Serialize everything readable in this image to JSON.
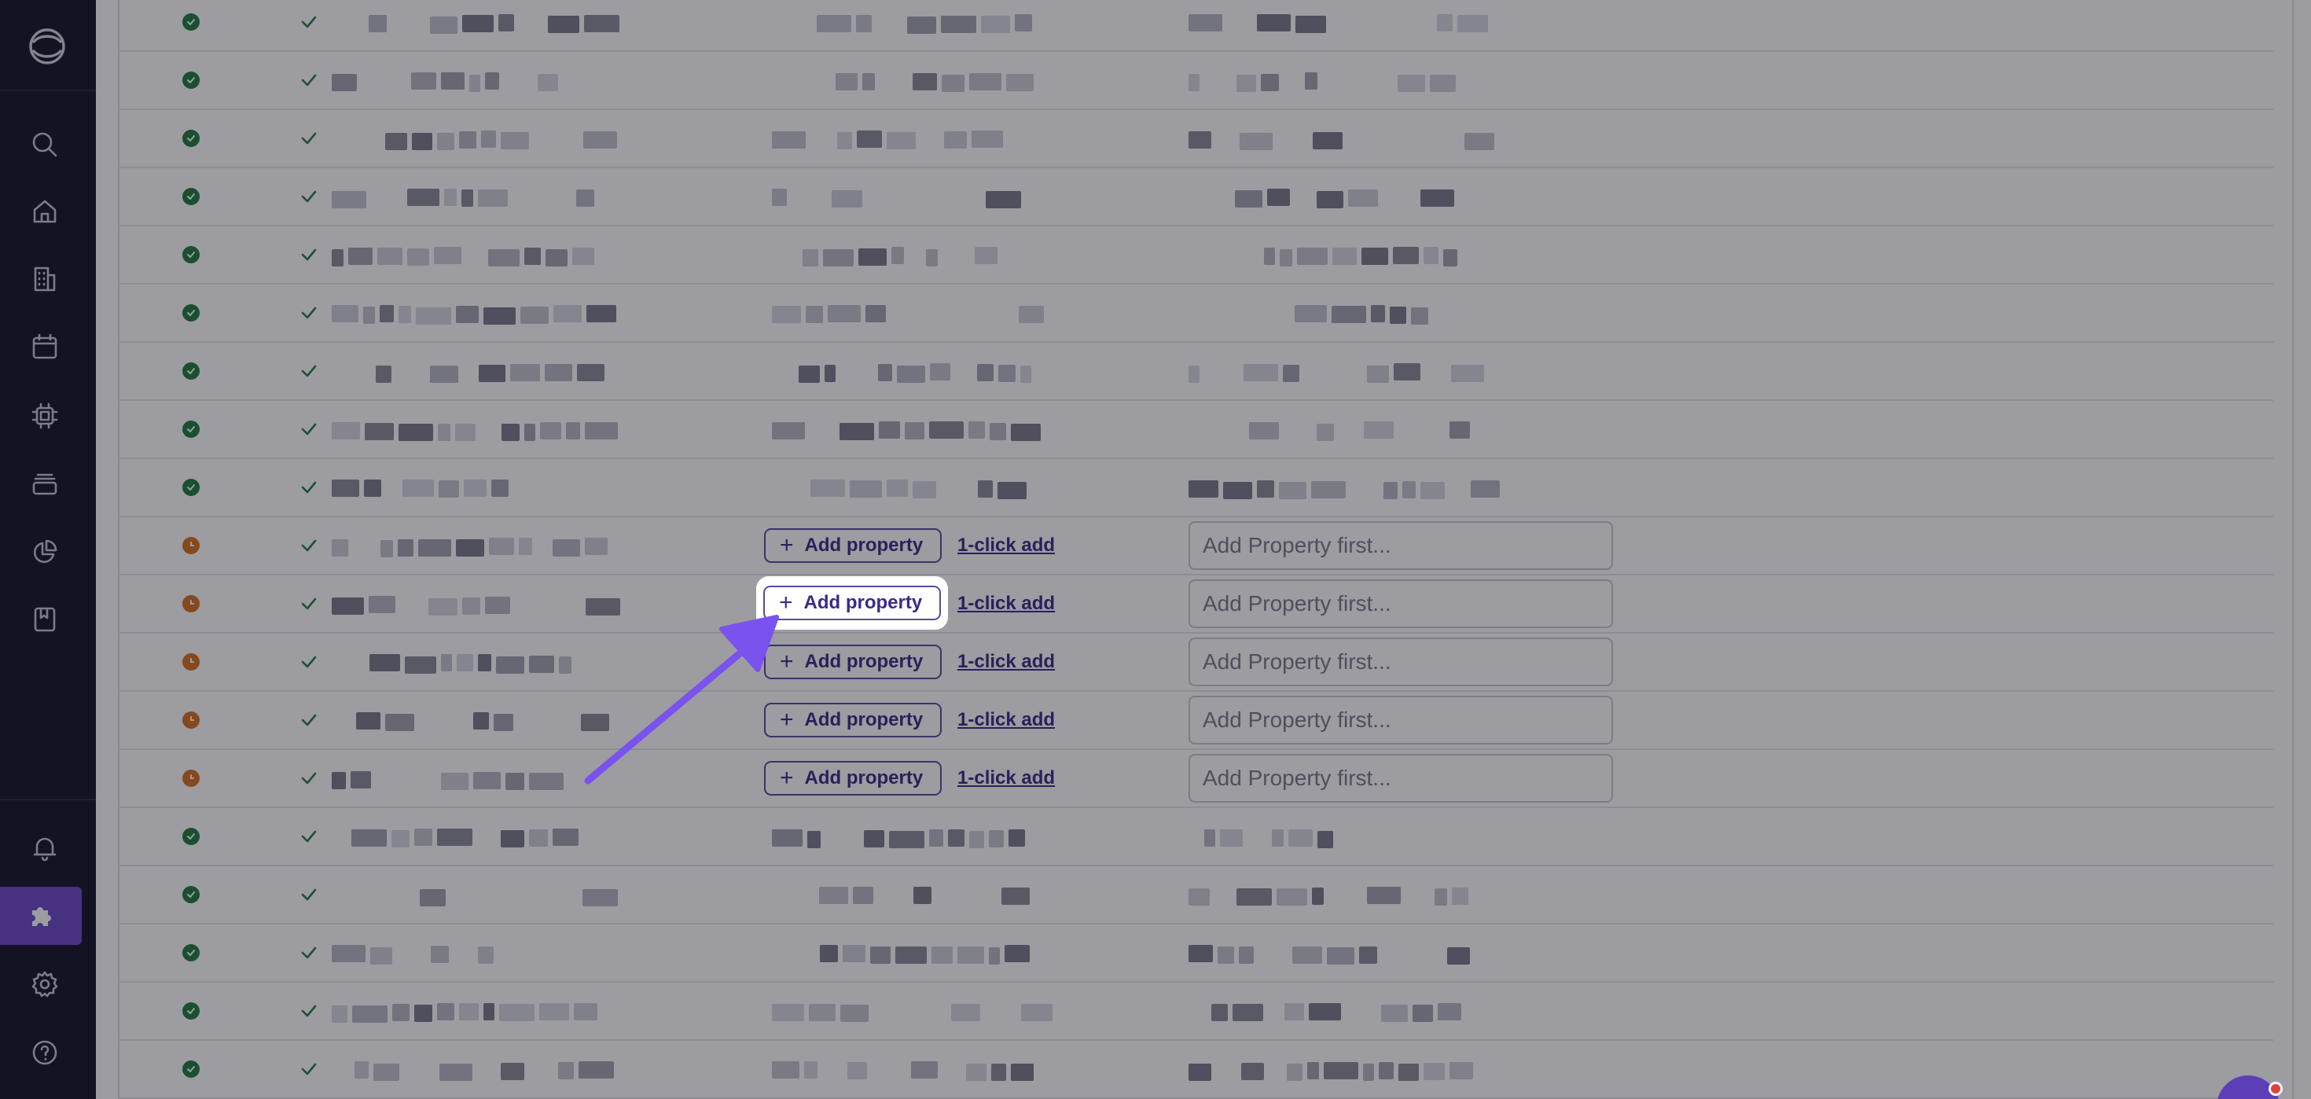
{
  "sidebar": {
    "logo_icon": "brand-ring-logo",
    "nav_icons": [
      "search-icon",
      "home-icon",
      "building-icon",
      "calendar-icon",
      "chip-icon",
      "inbox-icon",
      "pie-chart-icon",
      "book-icon"
    ],
    "bottom_icons": [
      "bell-icon",
      "puzzle-icon",
      "gear-icon",
      "help-icon"
    ],
    "active_item": "puzzle-icon",
    "accent_color": "#6b49c8"
  },
  "table": {
    "rows": [
      {
        "status": "ok",
        "checked": true,
        "has_property": true
      },
      {
        "status": "ok",
        "checked": true,
        "has_property": true
      },
      {
        "status": "ok",
        "checked": true,
        "has_property": true
      },
      {
        "status": "ok",
        "checked": true,
        "has_property": true
      },
      {
        "status": "ok",
        "checked": true,
        "has_property": true
      },
      {
        "status": "ok",
        "checked": true,
        "has_property": true
      },
      {
        "status": "ok",
        "checked": true,
        "has_property": true
      },
      {
        "status": "ok",
        "checked": true,
        "has_property": true
      },
      {
        "status": "ok",
        "checked": true,
        "has_property": true
      },
      {
        "status": "pending",
        "checked": true,
        "has_property": false,
        "add_property_label": "Add property",
        "one_click_label": "1-click add",
        "input_placeholder": "Add Property first..."
      },
      {
        "status": "pending",
        "checked": true,
        "has_property": false,
        "add_property_label": "Add property",
        "one_click_label": "1-click add",
        "input_placeholder": "Add Property first..."
      },
      {
        "status": "pending",
        "checked": true,
        "has_property": false,
        "add_property_label": "Add property",
        "one_click_label": "1-click add",
        "input_placeholder": "Add Property first..."
      },
      {
        "status": "pending",
        "checked": true,
        "has_property": false,
        "add_property_label": "Add property",
        "one_click_label": "1-click add",
        "input_placeholder": "Add Property first..."
      },
      {
        "status": "pending",
        "checked": true,
        "has_property": false,
        "add_property_label": "Add property",
        "one_click_label": "1-click add",
        "input_placeholder": "Add Property first..."
      },
      {
        "status": "ok",
        "checked": true,
        "has_property": true
      },
      {
        "status": "ok",
        "checked": true,
        "has_property": true
      },
      {
        "status": "ok",
        "checked": true,
        "has_property": true
      },
      {
        "status": "ok",
        "checked": true,
        "has_property": true
      },
      {
        "status": "ok",
        "checked": true,
        "has_property": true
      }
    ],
    "status_colors": {
      "ok": "#1f7a3d",
      "pending": "#d9701c"
    }
  },
  "highlight": {
    "add_property_label": "Add property",
    "arrow_color": "#7a52ee"
  },
  "chat": {
    "icon": "chat-bubble-icon",
    "badge_color": "#e0413c"
  }
}
